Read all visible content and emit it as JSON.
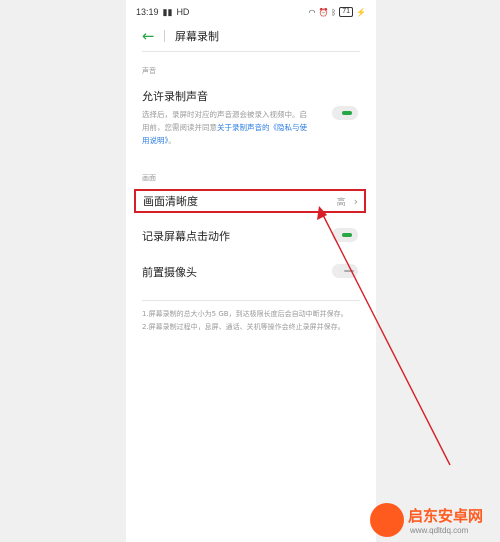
{
  "status_bar": {
    "time": "13:19",
    "network": "HD",
    "battery": "71"
  },
  "header": {
    "back_icon": "←",
    "title": "屏幕录制"
  },
  "sections": {
    "sound": "声音",
    "picture": "画面"
  },
  "allow_sound": {
    "title": "允许录制声音",
    "desc_pre": "选择后，录屏时对应的声音源会被录入视频中。启用前，您需阅读并同意",
    "desc_link": "关于录制声音的《隐私与使用说明》",
    "desc_post": "。",
    "enabled": true
  },
  "clarity": {
    "title": "画面清晰度",
    "value": "高"
  },
  "record_taps": {
    "title": "记录屏幕点击动作",
    "enabled": true
  },
  "front_camera": {
    "title": "前置摄像头",
    "enabled": false
  },
  "notes": {
    "line1": "1.屏幕录制的总大小为5 GB，到达极限长度后会自动中断并保存。",
    "line2": "2.屏幕录制过程中，息屏、通话、关机等操作会终止录屏并保存。"
  },
  "watermark": {
    "name": "启东安卓网",
    "url": "www.qdltdq.com"
  },
  "colors": {
    "accent_green": "#28a745",
    "highlight_red": "#d61f26",
    "link_blue": "#2a7de1",
    "watermark_orange": "#ff5b1f"
  }
}
